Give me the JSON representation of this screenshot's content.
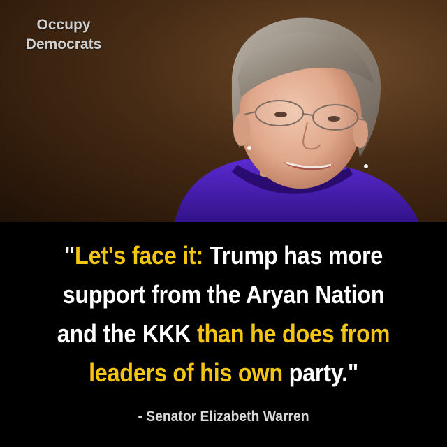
{
  "brand": {
    "line1": "Occupy",
    "line2": "Democrats"
  },
  "photo": {
    "subject": "woman-portrait-icon",
    "background_color": "#4a2e16",
    "jacket_color": "#4b1fb0"
  },
  "quote": {
    "line1": [
      {
        "text": "\"",
        "highlight": false
      },
      {
        "text": "Let's face it:",
        "highlight": true
      },
      {
        "text": " Trump has more",
        "highlight": false
      }
    ],
    "line2": [
      {
        "text": "support from the Aryan Nation",
        "highlight": false
      }
    ],
    "line3": [
      {
        "text": "and the KKK ",
        "highlight": false
      },
      {
        "text": "than he does from",
        "highlight": true
      }
    ],
    "line4": [
      {
        "text": "leaders of his own",
        "highlight": true
      },
      {
        "text": " party.\"",
        "highlight": false
      }
    ]
  },
  "attribution": "- Senator Elizabeth Warren",
  "colors": {
    "highlight": "#f2c414",
    "text": "#ffffff",
    "panel": "#000000"
  }
}
